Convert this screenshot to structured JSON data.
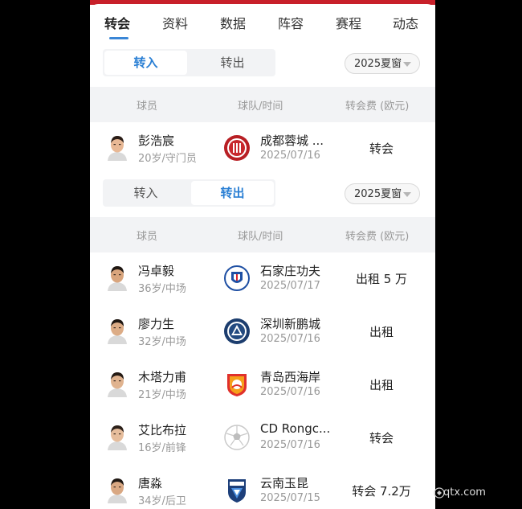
{
  "tabs": [
    {
      "label": "转会",
      "active": true
    },
    {
      "label": "资料"
    },
    {
      "label": "数据"
    },
    {
      "label": "阵容"
    },
    {
      "label": "赛程"
    },
    {
      "label": "动态"
    }
  ],
  "transfer_in": {
    "toggle": {
      "in_label": "转入",
      "out_label": "转出",
      "active": "in"
    },
    "season": "2025夏窗",
    "headers": {
      "player": "球员",
      "club_time": "球队/时间",
      "fee": "转会费 (欧元)"
    },
    "rows": [
      {
        "name": "彭浩宸",
        "info": "20岁/守门员",
        "club": "成都蓉城 ...",
        "date": "2025/07/16",
        "fee": "转会",
        "logo": "chengdu-rongcheng-logo"
      }
    ]
  },
  "transfer_out": {
    "toggle": {
      "in_label": "转入",
      "out_label": "转出",
      "active": "out"
    },
    "season": "2025夏窗",
    "headers": {
      "player": "球员",
      "club_time": "球队/时间",
      "fee": "转会费 (欧元)"
    },
    "rows": [
      {
        "name": "冯卓毅",
        "info": "36岁/中场",
        "club": "石家庄功夫",
        "date": "2025/07/17",
        "fee": "出租 5 万",
        "logo": "shijiazhuang-gongfu-logo"
      },
      {
        "name": "廖力生",
        "info": "32岁/中场",
        "club": "深圳新鹏城",
        "date": "2025/07/16",
        "fee": "出租",
        "logo": "shenzhen-xinpengcheng-logo"
      },
      {
        "name": "木塔力甫",
        "info": "21岁/中场",
        "club": "青岛西海岸",
        "date": "2025/07/16",
        "fee": "出租",
        "logo": "qingdao-west-coast-logo"
      },
      {
        "name": "艾比布拉",
        "info": "16岁/前锋",
        "club": "CD Rongc...",
        "date": "2025/07/16",
        "fee": "转会",
        "logo": "soccer-ball-logo"
      },
      {
        "name": "唐淼",
        "info": "34岁/后卫",
        "club": "云南玉昆",
        "date": "2025/07/15",
        "fee": "转会 7.2万",
        "logo": "yunnan-yukun-logo"
      }
    ]
  },
  "watermark": "qtx.com",
  "colors": {
    "accent": "#2a7fd4",
    "brand_red": "#c8202a",
    "header_bg": "#f2f3f5"
  }
}
